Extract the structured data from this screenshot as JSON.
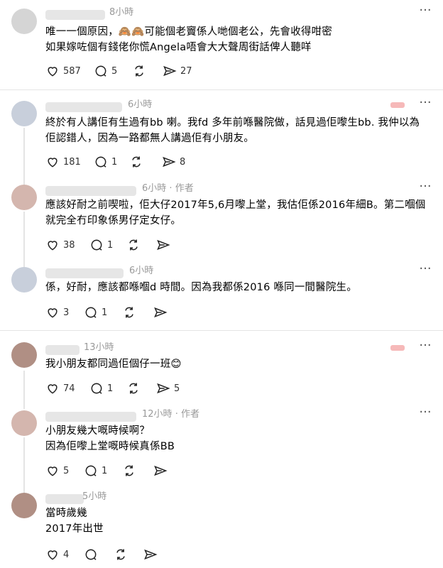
{
  "posts": [
    {
      "time": "8小時",
      "author_tag": "",
      "text": "唯一一個原因，🙈🙈可能個老竇係人哋個老公，先會收得咁密\n如果嫁咗個有錢佬你慌Angela唔會大大聲周街話俾人聽咩",
      "likes": "587",
      "replies": "5",
      "reposts": "",
      "shares": "27",
      "icon_names": [
        "heart-icon",
        "comment-icon",
        "repost-icon",
        "share-icon",
        "more-icon"
      ]
    },
    {
      "time": "6小時",
      "author_tag": "",
      "text": "終於有人講佢有生過有bb 喇。我fd 多年前喺醫院做，話見過佢嚟生bb. 我仲以為\n佢認錯人，因為一路都無人講過佢有小朋友。",
      "likes": "181",
      "replies": "1",
      "reposts": "",
      "shares": "8"
    },
    {
      "time": "6小時",
      "author_tag": "作者",
      "text": "應該好耐之前喫啦，佢大仔2017年5,6月嚟上堂，我估佢係2016年細B。第二嗰個\n就完全冇印象係男仔定女仔。",
      "likes": "38",
      "replies": "1",
      "reposts": "",
      "shares": ""
    },
    {
      "time": "6小時",
      "author_tag": "",
      "text": "係，好耐，應該都喺嗰d 時間。因為我都係2016 喺同一間醫院生。",
      "likes": "3",
      "replies": "1",
      "reposts": "",
      "shares": ""
    },
    {
      "time": "13小時",
      "author_tag": "",
      "text": "我小朋友都同過佢個仔一班😊",
      "likes": "74",
      "replies": "1",
      "reposts": "",
      "shares": "5"
    },
    {
      "time": "12小時",
      "author_tag": "作者",
      "text": "小朋友幾大嘅時候啊？\n因為佢嚟上堂嘅時候真係BB",
      "likes": "5",
      "replies": "1",
      "reposts": "",
      "shares": ""
    },
    {
      "time": "5小時",
      "author_tag": "",
      "text": "當時歲幾\n2017年出世",
      "likes": "4",
      "replies": "",
      "reposts": "",
      "shares": ""
    }
  ],
  "separator": "·",
  "more_glyph": "···"
}
